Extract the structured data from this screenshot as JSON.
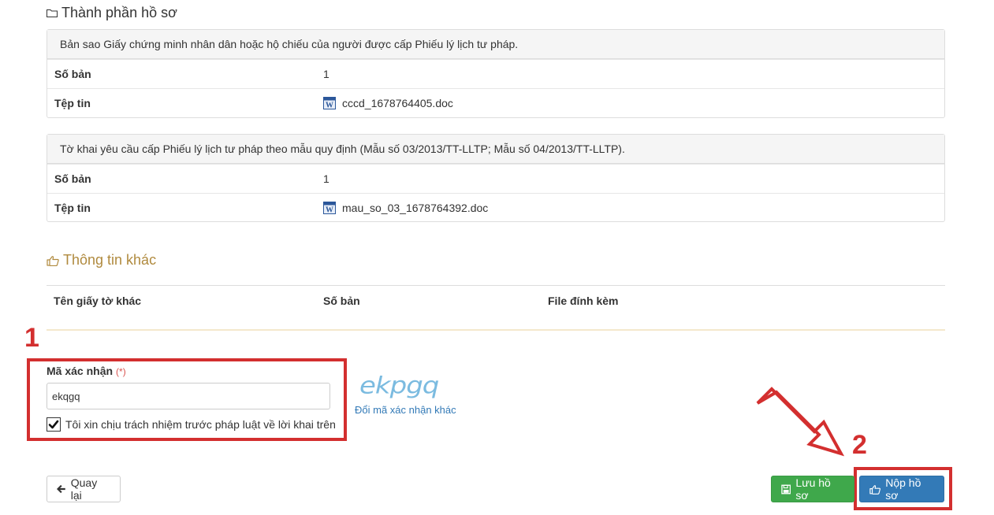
{
  "documents": {
    "title": "Thành phần hồ sơ",
    "items": [
      {
        "name": "Bản sao Giấy chứng minh nhân dân hoặc hộ chiếu của người được cấp Phiếu lý lịch tư pháp.",
        "copies_label": "Số bản",
        "copies": "1",
        "file_label": "Tệp tin",
        "file": "cccd_1678764405.doc"
      },
      {
        "name": "Tờ khai yêu cầu cấp Phiếu lý lịch tư pháp theo mẫu quy định (Mẫu số 03/2013/TT-LLTP; Mẫu số 04/2013/TT-LLTP).",
        "copies_label": "Số bản",
        "copies": "1",
        "file_label": "Tệp tin",
        "file": "mau_so_03_1678764392.doc"
      }
    ]
  },
  "other_info": {
    "title": "Thông tin khác",
    "columns": [
      "Tên giấy tờ khác",
      "Số bản",
      "File đính kèm"
    ]
  },
  "captcha": {
    "label": "Mã xác nhận",
    "required_mark": "(*)",
    "value": "ekqgq",
    "image_text": "ekpgq",
    "refresh_label": "Đổi mã xác nhận khác"
  },
  "agreement": {
    "label": "Tôi xin chịu trách nhiệm trước pháp luật về lời khai trên",
    "checked": true
  },
  "buttons": {
    "back": "Quay lại",
    "save": "Lưu hồ sơ",
    "submit": "Nộp hồ sơ"
  },
  "annotations": {
    "step1": "1",
    "step2": "2",
    "color": "#d32f2f"
  }
}
